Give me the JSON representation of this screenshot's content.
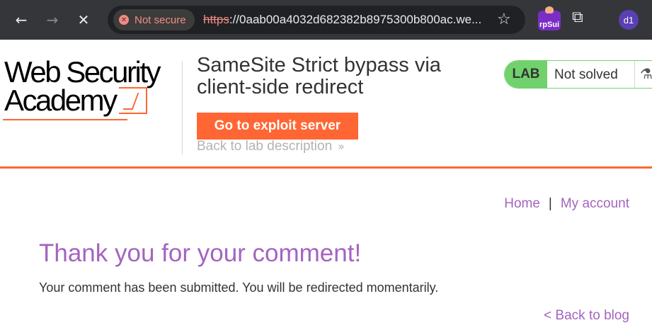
{
  "browser": {
    "back_glyph": "←",
    "forward_glyph": "→",
    "stop_glyph": "✕",
    "security_label": "Not secure",
    "url_scheme": "https",
    "url_rest": "://0aab00a4032d682382b8975300b800ac.we...",
    "star_glyph": "☆",
    "extension_label": "rpSui",
    "puzzle_glyph": "⧉",
    "profile_initials": "d1",
    "icons": [
      "back-arrow-icon",
      "forward-arrow-icon",
      "stop-icon",
      "not-secure-icon",
      "bookmark-star-icon",
      "burp-extension-icon",
      "extensions-puzzle-icon",
      "profile-avatar"
    ]
  },
  "lab_header": {
    "logo_line1": "Web Security",
    "logo_line2": "Academy",
    "title": "SameSite Strict bypass via client-side redirect",
    "exploit_button": "Go to exploit server",
    "back_link": "Back to lab description",
    "back_chevrons": "»",
    "status_badge": "LAB",
    "status_text": "Not solved",
    "flask_glyph": "⚗"
  },
  "nav": {
    "home": "Home",
    "separator": "|",
    "account": "My account"
  },
  "main": {
    "heading": "Thank you for your comment!",
    "message": "Your comment has been submitted. You will be redirected momentarily.",
    "back_link": "< Back to blog"
  },
  "colors": {
    "accent_orange": "#ff6633",
    "link_purple": "#a464bf",
    "status_green": "#70d16d",
    "chrome_dark": "#35363a"
  }
}
